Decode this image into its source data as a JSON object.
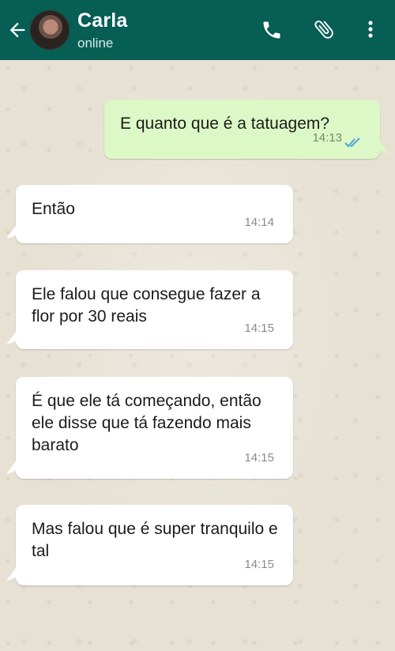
{
  "header": {
    "contact_name": "Carla",
    "status": "online",
    "icons": {
      "back": "arrow-left-icon",
      "call": "phone-icon",
      "attach": "paperclip-icon",
      "menu": "more-vertical-icon"
    }
  },
  "colors": {
    "header_bg": "#075e54",
    "outgoing_bubble": "#dcf8c6",
    "incoming_bubble": "#ffffff",
    "read_ticks": "#4fc3f7"
  },
  "messages": [
    {
      "direction": "out",
      "text": "E quanto que é a tatuagem?",
      "time": "14:13",
      "read": true
    },
    {
      "direction": "in",
      "text": "Então",
      "time": "14:14"
    },
    {
      "direction": "in",
      "text": "Ele falou que consegue fazer a flor por 30 reais",
      "time": "14:15"
    },
    {
      "direction": "in",
      "text": "É que ele tá começando, então ele disse que tá fazendo mais barato",
      "time": "14:15"
    },
    {
      "direction": "in",
      "text": "Mas falou que é super tranquilo e tal",
      "time": "14:15"
    }
  ]
}
